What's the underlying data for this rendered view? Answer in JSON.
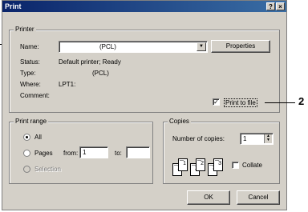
{
  "window": {
    "title": "Print",
    "help_button": "?",
    "close_button": "×"
  },
  "printer": {
    "group_label": "Printer",
    "name_label": "Name:",
    "name_value": "(PCL)",
    "properties_button": "Properties",
    "status_label": "Status:",
    "status_value": "Default printer; Ready",
    "type_label": "Type:",
    "type_value": "(PCL)",
    "where_label": "Where:",
    "where_value": "LPT1:",
    "comment_label": "Comment:",
    "print_to_file_label": "Print to file",
    "print_to_file_checked": true
  },
  "print_range": {
    "group_label": "Print range",
    "all_label": "All",
    "pages_label": "Pages",
    "from_label": "from:",
    "from_value": "1",
    "to_label": "to:",
    "to_value": "",
    "selection_label": "Selection"
  },
  "copies": {
    "group_label": "Copies",
    "number_label": "Number of copies:",
    "number_value": "1",
    "collate_label": "Collate",
    "collate_checked": false,
    "page_numbers": [
      "1",
      "1",
      "2",
      "2",
      "3",
      "3"
    ]
  },
  "footer": {
    "ok_button": "OK",
    "cancel_button": "Cancel"
  },
  "callouts": {
    "right_number": "2"
  }
}
